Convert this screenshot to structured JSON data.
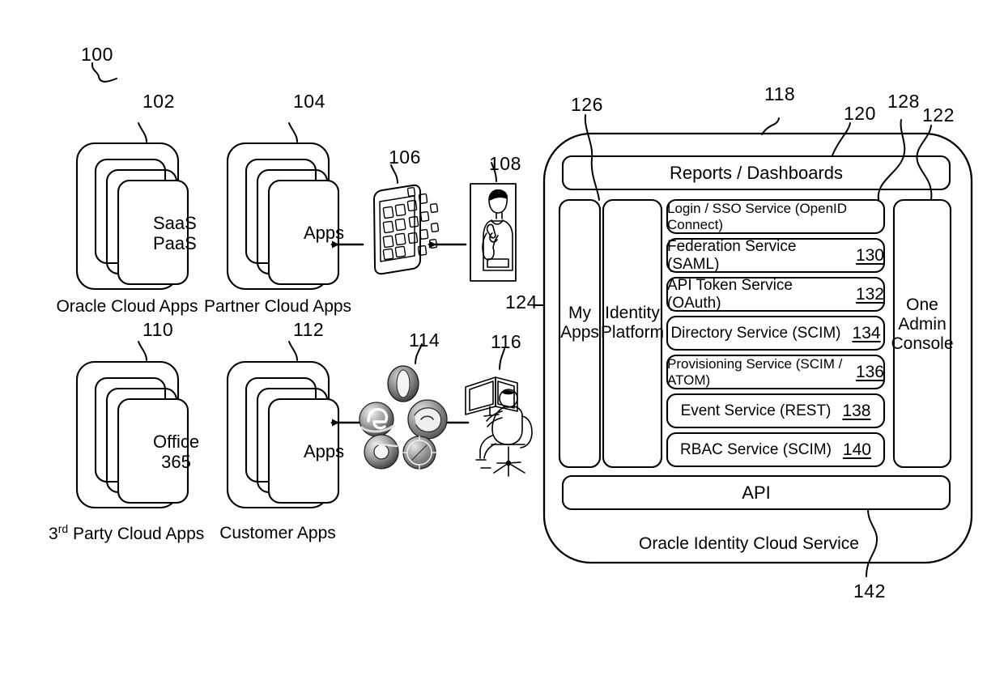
{
  "figure": {
    "title": "Oracle Identity Cloud Service architecture",
    "figure_ref": "100",
    "line_color": "#000000",
    "background": "#ffffff"
  },
  "refs": {
    "r100": "100",
    "r102": "102",
    "r104": "104",
    "r106": "106",
    "r108": "108",
    "r110": "110",
    "r112": "112",
    "r114": "114",
    "r116": "116",
    "r118": "118",
    "r120": "120",
    "r122": "122",
    "r124": "124",
    "r126": "126",
    "r128": "128",
    "r142": "142"
  },
  "app_groups": [
    {
      "ref": "102",
      "card_line1": "SaaS",
      "card_line2": "PaaS",
      "label": "Oracle Cloud Apps",
      "label_prefix": "",
      "label_sup": ""
    },
    {
      "ref": "104",
      "card_line1": "Apps",
      "card_line2": "",
      "label": "Partner Cloud Apps",
      "label_prefix": "",
      "label_sup": ""
    },
    {
      "ref": "110",
      "card_line1": "Office",
      "card_line2": "365",
      "label": "Party Cloud Apps",
      "label_prefix": "3",
      "label_sup": "rd"
    },
    {
      "ref": "112",
      "card_line1": "Apps",
      "card_line2": "",
      "label": "Customer Apps",
      "label_prefix": "",
      "label_sup": ""
    }
  ],
  "actors": {
    "mobile_device": {
      "ref": "106",
      "icon": "mobile-phone-apps-icon"
    },
    "mobile_user": {
      "ref": "108",
      "icon": "person-with-phone-icon"
    },
    "browsers": {
      "ref": "114",
      "icon": "browser-logos-icon",
      "items": [
        "opera-browser-icon",
        "internet-explorer-browser-icon",
        "firefox-browser-icon",
        "chrome-browser-icon",
        "safari-browser-icon"
      ]
    },
    "desktop_user": {
      "ref": "116",
      "icon": "person-at-desktop-icon"
    }
  },
  "cloud_service": {
    "ref": "118",
    "footer_label": "Oracle Identity Cloud Service",
    "footer_ref": "142",
    "reports_bar": {
      "ref": "120",
      "label": "Reports / Dashboards"
    },
    "api_bar": {
      "label": "API"
    },
    "columns": [
      {
        "ref": "126",
        "line1": "My",
        "line2": "Apps"
      },
      {
        "ref": "",
        "line1": "Identity",
        "line2": "Platform"
      }
    ],
    "admin_console": {
      "ref": "122",
      "line1": "One",
      "line2": "Admin",
      "line3": "Console"
    },
    "services": [
      {
        "label": "Login / SSO Service (OpenID Connect)",
        "num": "",
        "ref_callout": "128",
        "condensed": true
      },
      {
        "label": "Federation Service (SAML)",
        "num": "130",
        "condensed": false
      },
      {
        "label": "API Token Service (OAuth)",
        "num": "132",
        "condensed": false
      },
      {
        "label": "Directory Service (SCIM)",
        "num": "134",
        "condensed": false
      },
      {
        "label": "Provisioning Service (SCIM / ATOM)",
        "num": "136",
        "condensed": true
      },
      {
        "label": "Event Service (REST)",
        "num": "138",
        "condensed": false
      },
      {
        "label": "RBAC Service (SCIM)",
        "num": "140",
        "condensed": false
      }
    ]
  },
  "flow_arrows": [
    {
      "name": "arrow-mobile-to-partner-apps",
      "direction": "left"
    },
    {
      "name": "arrow-user-to-mobile",
      "direction": "left"
    },
    {
      "name": "arrow-browsers-to-customer-apps",
      "direction": "left"
    },
    {
      "name": "arrow-desktop-user-to-browsers",
      "direction": "left"
    }
  ]
}
